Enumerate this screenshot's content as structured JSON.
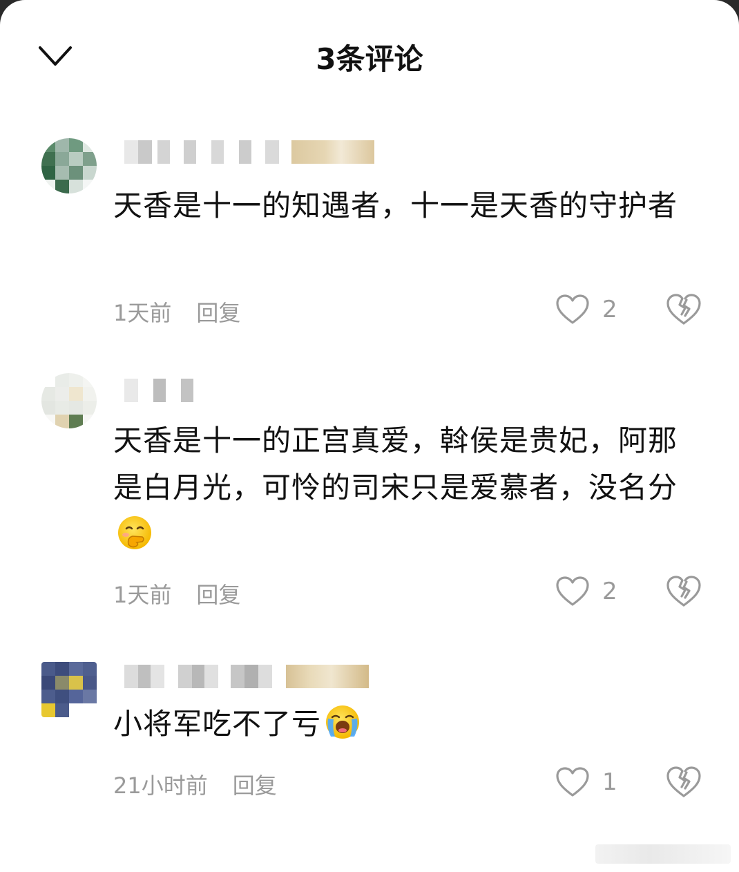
{
  "header": {
    "title": "3条评论"
  },
  "comments": [
    {
      "text": "天香是十一的知遇者，十一是天香的守护者",
      "time": "1天前",
      "reply_label": "回复",
      "likes": "2"
    },
    {
      "text": "天香是十一的正宫真爱，斡侯是贵妃，阿那是白月光，可怜的司宋只是爱慕者，没名分",
      "time": "1天前",
      "reply_label": "回复",
      "likes": "2",
      "emoji": "face-with-hand-over-mouth"
    },
    {
      "text": "小将军吃不了亏",
      "time": "21小时前",
      "reply_label": "回复",
      "likes": "1",
      "emoji": "loudly-crying-face"
    }
  ],
  "icons": {
    "close": "chevron-down-icon",
    "like": "heart-outline-icon",
    "dislike": "broken-heart-icon"
  },
  "colors": {
    "text": "#111111",
    "meta": "#9a9a9a",
    "background": "#ffffff"
  }
}
